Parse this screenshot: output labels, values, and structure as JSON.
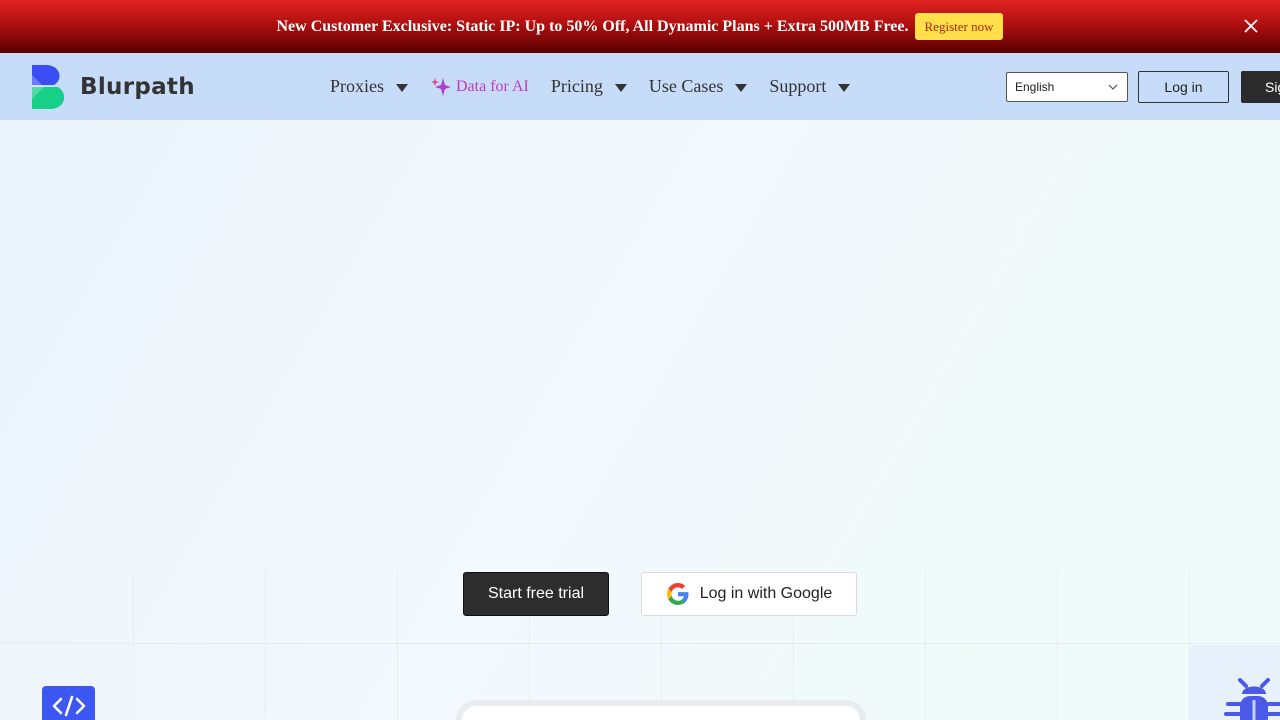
{
  "promo": {
    "text": "New Customer Exclusive: Static IP: Up to 50% Off, All Dynamic Plans + Extra 500MB Free.",
    "button": "Register now",
    "close_icon": "close-icon",
    "colors": {
      "banner": "#c41414",
      "button": "#ffdf4a",
      "button_text": "#b0261b"
    }
  },
  "nav": {
    "brand": "Blurpath",
    "menu": [
      {
        "label": "Proxies",
        "dropdown": true
      },
      {
        "label": "Data for AI",
        "dropdown": false,
        "icon": "sparkle-icon"
      },
      {
        "label": "Pricing",
        "dropdown": true
      },
      {
        "label": "Use Cases",
        "dropdown": true
      },
      {
        "label": "Support",
        "dropdown": true
      }
    ],
    "language": "English",
    "login": "Log in",
    "signup": "Sign up",
    "colors": {
      "bar": "#c6dcf9",
      "ai_accent": "#c03bb9"
    }
  },
  "hero": {
    "primary_cta": "Start free trial",
    "google_cta": "Log in with Google",
    "left_card_icon": "code-icon",
    "right_card_icon": "bug-icon",
    "colors": {
      "badge": "#3d57f2"
    }
  }
}
